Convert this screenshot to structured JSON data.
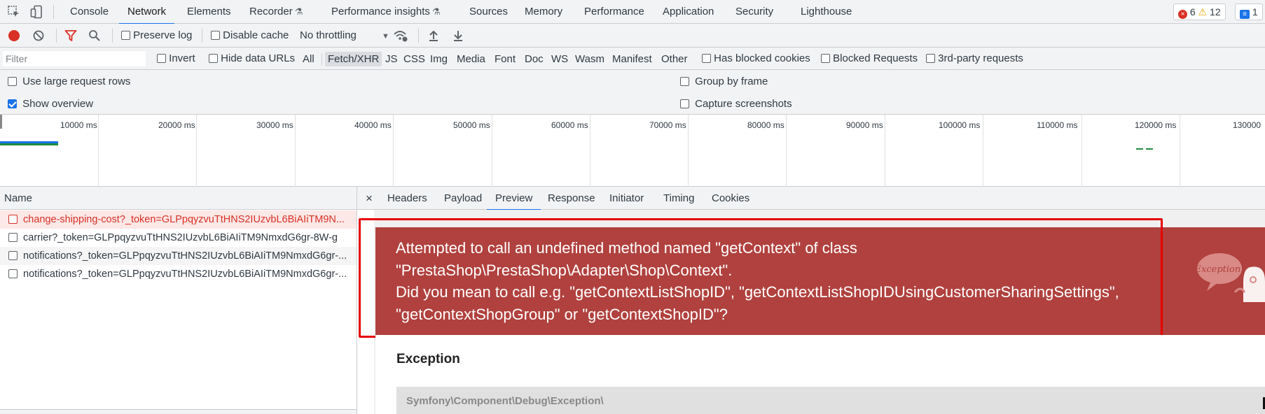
{
  "tabs": [
    {
      "label": "Console"
    },
    {
      "label": "Network"
    },
    {
      "label": "Elements"
    },
    {
      "label": "Recorder"
    },
    {
      "label": "Performance insights"
    },
    {
      "label": "Sources"
    },
    {
      "label": "Memory"
    },
    {
      "label": "Performance"
    },
    {
      "label": "Application"
    },
    {
      "label": "Security"
    },
    {
      "label": "Lighthouse"
    }
  ],
  "active_tab": "Network",
  "badges": {
    "errors": "6",
    "warnings": "12",
    "messages": "1"
  },
  "toolbar": {
    "preserve_log": "Preserve log",
    "disable_cache": "Disable cache",
    "throttling": "No throttling"
  },
  "filter": {
    "placeholder": "Filter",
    "invert": "Invert",
    "hide_data_urls": "Hide data URLs",
    "types": [
      "All",
      "Fetch/XHR",
      "JS",
      "CSS",
      "Img",
      "Media",
      "Font",
      "Doc",
      "WS",
      "Wasm",
      "Manifest",
      "Other"
    ],
    "active_type": "Fetch/XHR",
    "has_blocked_cookies": "Has blocked cookies",
    "blocked_requests": "Blocked Requests",
    "third_party": "3rd-party requests"
  },
  "settings": {
    "large_rows": "Use large request rows",
    "show_overview": "Show overview",
    "group_by_frame": "Group by frame",
    "capture_screenshots": "Capture screenshots"
  },
  "overview": {
    "ticks": [
      "10000 ms",
      "20000 ms",
      "30000 ms",
      "40000 ms",
      "50000 ms",
      "60000 ms",
      "70000 ms",
      "80000 ms",
      "90000 ms",
      "100000 ms",
      "110000 ms",
      "120000 ms",
      "130000"
    ]
  },
  "requests": {
    "column_name": "Name",
    "rows": [
      {
        "name": "change-shipping-cost?_token=GLPpqyzvuTtHNS2IUzvbL6BiAIiTM9N...",
        "status": "error"
      },
      {
        "name": "carrier?_token=GLPpqyzvuTtHNS2IUzvbL6BiAIiTM9NmxdG6gr-8W-g",
        "status": "ok"
      },
      {
        "name": "notifications?_token=GLPpqyzvuTtHNS2IUzvbL6BiAIiTM9NmxdG6gr-...",
        "status": "ok"
      },
      {
        "name": "notifications?_token=GLPpqyzvuTtHNS2IUzvbL6BiAIiTM9NmxdG6gr-...",
        "status": "ok"
      }
    ]
  },
  "detail": {
    "close": "×",
    "tabs": [
      "Headers",
      "Payload",
      "Preview",
      "Response",
      "Initiator",
      "Timing",
      "Cookies"
    ],
    "active_tab": "Preview"
  },
  "exception": {
    "message_lines": [
      "Attempted to call an undefined method named \"getContext\" of class",
      "\"PrestaShop\\PrestaShop\\Adapter\\Shop\\Context\".",
      "Did you mean to call e.g. \"getContextListShopID\", \"getContextListShopIDUsingCustomerSharingSettings\",",
      "\"getContextShopGroup\" or \"getContextShopID\"?"
    ],
    "title": "Exception",
    "trace": "Symfony\\Component\\Debug\\Exception\\",
    "bubble": "Exception!"
  },
  "colors": {
    "accent": "#1a73e8",
    "error": "#d93025",
    "exception_bg": "#b0413e",
    "highlight": "#e60000"
  }
}
